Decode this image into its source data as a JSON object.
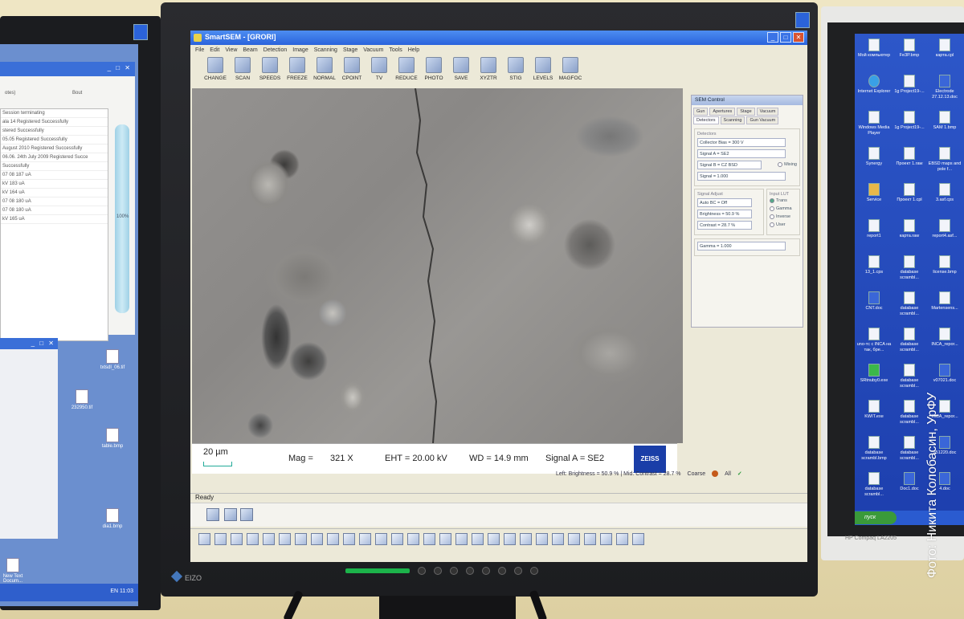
{
  "left_monitor": {
    "window_title": "",
    "field_label": "otes)",
    "field_label2": "Bout",
    "log_lines": [
      "Session terminating",
      "ala 14  Registered Successfully",
      "stered Successfully",
      "05.05 Registered Successfully",
      "August 2010 Registered Successfully",
      "06.06. 24th July 2009 Registered Succe",
      "Successfully",
      "07 08  187 uA",
      "kV  183 uA",
      "  kV  164 uA",
      "07 08  180 uA",
      "07 08  180 uA",
      "kV  165 uA"
    ],
    "progress_label": "100%",
    "desktop_icons": [
      "txtsdl_06.tif",
      "232950.tif",
      "table.bmp",
      "dia1.bmp",
      "New Text Docum..."
    ],
    "taskbar_text": "EN  11:03"
  },
  "app": {
    "title": "SmartSEM - [GRORI]",
    "menu": [
      "File",
      "Edit",
      "View",
      "Beam",
      "Detection",
      "Image",
      "Scanning",
      "Stage",
      "Vacuum",
      "Tools",
      "Help"
    ],
    "toolbar": [
      "CHANGE",
      "SCAN",
      "SPEEDS",
      "FREEZE",
      "NORMAL",
      "CPOINT",
      "TV",
      "REDUCE",
      "PHOTO",
      "SAVE",
      "XYZTR",
      "STIG",
      "LEVELS",
      "MAGFOC"
    ],
    "image_info": {
      "scale": "20 µm",
      "mag_label": "Mag =",
      "mag_value": "321 X",
      "eht": "EHT = 20.00 kV",
      "wd": "WD = 14.9 mm",
      "signal": "Signal A = SE2",
      "brand": "ZEISS"
    },
    "control": {
      "title": "SEM Control",
      "tabs": [
        "Gun",
        "Apertures",
        "Stage",
        "Vacuum"
      ],
      "subtabs": [
        "Detectors",
        "Scanning",
        "Gun Vacuum"
      ],
      "detectors_label": "Detectors",
      "collector_bias": "Collector Bias = 300 V",
      "signal_a": "Signal A = SE2",
      "signal_b": "Signal B = CZ BSD",
      "mixing": "Mixing",
      "signal": "Signal = 1.000",
      "signal_adjust_label": "Signal Adjust",
      "auto_bc": "Auto BC = Off",
      "brightness": "Brightness = 50.9 %",
      "contrast": "Contrast = 28.7 %",
      "gamma": "Gamma = 1.000",
      "input_lut_label": "Input LUT",
      "lut_options": [
        "Trans",
        "Gamma",
        "Inverse",
        "User"
      ]
    },
    "status_line": {
      "left": "Left: Brightness = 50.9 % | Mid: Contrast = 28.7 %",
      "coarse": "Coarse",
      "all": "All"
    },
    "ready": "Ready"
  },
  "monitor_brand": "EIZO",
  "right_monitor": {
    "icons": [
      [
        "Мой компьютер",
        "Fe3P.bmp",
        "карта.cpl"
      ],
      [
        "Internet Explorer",
        "1g Project19-...",
        "Electrode 27.12.13.doc"
      ],
      [
        "Windows Media Player",
        "1g Project19-...",
        "SAM 1.bmp"
      ],
      [
        "Synergy",
        "Проект 1.raw",
        "EBSD maps and pole f..."
      ],
      [
        "Service",
        "Проект 1.cpl",
        "3.asf.cps"
      ],
      [
        "report1",
        "карта.raw",
        "report4.asf..."
      ],
      [
        "13_1.cps",
        "database scrambl...",
        "license.bmp"
      ],
      [
        "CNT.doc",
        "database scrambl...",
        "Martensens..."
      ],
      [
        "uno-тс с INCA на так, бре...",
        "database scrambl...",
        "INCA_repor..."
      ],
      [
        "SRtnuby0.exe",
        "database scrambl...",
        "v07021.doc"
      ],
      [
        "KWIT.exe",
        "database scrambl...",
        "INCA_repor..."
      ],
      [
        "database scrambl.bmp",
        "database scrambl...",
        "251220.doc"
      ],
      [
        "database scrambl...",
        "Doc1.doc",
        "4.doc"
      ]
    ],
    "start": "пуск",
    "taskbar": "INCA",
    "brand": "HP Compaq LA2205"
  },
  "watermark": "Фото: Никита Колобасин, УрФУ"
}
